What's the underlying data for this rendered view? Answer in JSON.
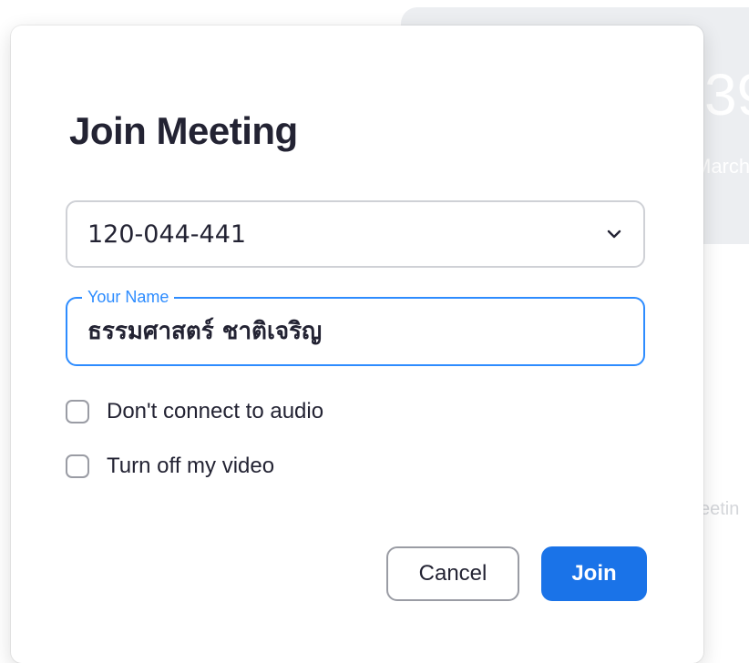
{
  "background": {
    "clock_fragment": "39",
    "date_fragment": "March",
    "meeting_fragment": "eetin"
  },
  "dialog": {
    "title": "Join Meeting",
    "meeting_id": {
      "value": "120-044-441",
      "icon": "chevron-down-icon"
    },
    "name_field": {
      "legend": "Your Name",
      "value": "ธรรมศาสตร์ ชาติเจริญ"
    },
    "options": [
      {
        "label": "Don't connect to audio",
        "checked": false
      },
      {
        "label": "Turn off my video",
        "checked": false
      }
    ],
    "buttons": {
      "cancel": "Cancel",
      "join": "Join"
    }
  },
  "colors": {
    "accent": "#2d8cff",
    "primary_button": "#1a73e8",
    "text": "#232333"
  }
}
